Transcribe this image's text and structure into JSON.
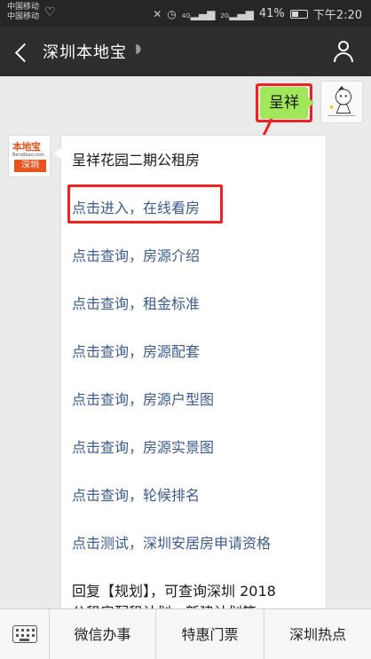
{
  "status_bar": {
    "carrier1": "中国移动",
    "carrier2": "中国移动",
    "signal1": "4G",
    "signal2": "2G",
    "battery": "41%",
    "time": "下午2:20"
  },
  "header": {
    "title": "深圳本地宝"
  },
  "chat": {
    "self_message": "呈祥",
    "bot_logo": {
      "brand": "本地宝",
      "url": "Bendibao.com",
      "city": "深圳"
    },
    "reply_lines": [
      {
        "text": "呈祥花园二期公租房",
        "type": "plain"
      },
      {
        "text": "点击进入，在线看房",
        "type": "link"
      },
      {
        "text": "点击查询，房源介绍",
        "type": "link"
      },
      {
        "text": "点击查询，租金标准",
        "type": "link"
      },
      {
        "text": "点击查询，房源配套",
        "type": "link"
      },
      {
        "text": "点击查询，房源户型图",
        "type": "link"
      },
      {
        "text": "点击查询，房源实景图",
        "type": "link"
      },
      {
        "text": "点击查询，轮候排名",
        "type": "link"
      },
      {
        "text": "点击测试，深圳安居房申请资格",
        "type": "link"
      },
      {
        "text": "回复【规划】，可查询深圳 2018",
        "type": "plain"
      },
      {
        "text": "公租房配租计划、新建计划等",
        "type": "plain"
      }
    ]
  },
  "bottom_menu": {
    "items": [
      "微信办事",
      "特惠门票",
      "深圳热点"
    ]
  },
  "colors": {
    "status_bg": "#262626",
    "header_bg": "#2e2e2e",
    "chat_bg": "#ebebeb",
    "self_bubble": "#a0e75a",
    "link": "#3d5b8c",
    "annotation_red": "#e22222",
    "brand_orange": "#e8531c"
  }
}
